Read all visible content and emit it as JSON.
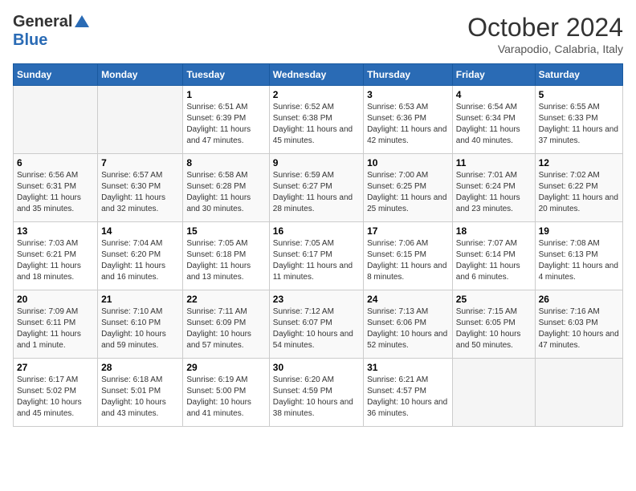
{
  "header": {
    "logo_general": "General",
    "logo_blue": "Blue",
    "month_title": "October 2024",
    "subtitle": "Varapodio, Calabria, Italy"
  },
  "days_of_week": [
    "Sunday",
    "Monday",
    "Tuesday",
    "Wednesday",
    "Thursday",
    "Friday",
    "Saturday"
  ],
  "weeks": [
    [
      {
        "day": null,
        "info": null
      },
      {
        "day": null,
        "info": null
      },
      {
        "day": "1",
        "info": "Sunrise: 6:51 AM\nSunset: 6:39 PM\nDaylight: 11 hours and 47 minutes."
      },
      {
        "day": "2",
        "info": "Sunrise: 6:52 AM\nSunset: 6:38 PM\nDaylight: 11 hours and 45 minutes."
      },
      {
        "day": "3",
        "info": "Sunrise: 6:53 AM\nSunset: 6:36 PM\nDaylight: 11 hours and 42 minutes."
      },
      {
        "day": "4",
        "info": "Sunrise: 6:54 AM\nSunset: 6:34 PM\nDaylight: 11 hours and 40 minutes."
      },
      {
        "day": "5",
        "info": "Sunrise: 6:55 AM\nSunset: 6:33 PM\nDaylight: 11 hours and 37 minutes."
      }
    ],
    [
      {
        "day": "6",
        "info": "Sunrise: 6:56 AM\nSunset: 6:31 PM\nDaylight: 11 hours and 35 minutes."
      },
      {
        "day": "7",
        "info": "Sunrise: 6:57 AM\nSunset: 6:30 PM\nDaylight: 11 hours and 32 minutes."
      },
      {
        "day": "8",
        "info": "Sunrise: 6:58 AM\nSunset: 6:28 PM\nDaylight: 11 hours and 30 minutes."
      },
      {
        "day": "9",
        "info": "Sunrise: 6:59 AM\nSunset: 6:27 PM\nDaylight: 11 hours and 28 minutes."
      },
      {
        "day": "10",
        "info": "Sunrise: 7:00 AM\nSunset: 6:25 PM\nDaylight: 11 hours and 25 minutes."
      },
      {
        "day": "11",
        "info": "Sunrise: 7:01 AM\nSunset: 6:24 PM\nDaylight: 11 hours and 23 minutes."
      },
      {
        "day": "12",
        "info": "Sunrise: 7:02 AM\nSunset: 6:22 PM\nDaylight: 11 hours and 20 minutes."
      }
    ],
    [
      {
        "day": "13",
        "info": "Sunrise: 7:03 AM\nSunset: 6:21 PM\nDaylight: 11 hours and 18 minutes."
      },
      {
        "day": "14",
        "info": "Sunrise: 7:04 AM\nSunset: 6:20 PM\nDaylight: 11 hours and 16 minutes."
      },
      {
        "day": "15",
        "info": "Sunrise: 7:05 AM\nSunset: 6:18 PM\nDaylight: 11 hours and 13 minutes."
      },
      {
        "day": "16",
        "info": "Sunrise: 7:05 AM\nSunset: 6:17 PM\nDaylight: 11 hours and 11 minutes."
      },
      {
        "day": "17",
        "info": "Sunrise: 7:06 AM\nSunset: 6:15 PM\nDaylight: 11 hours and 8 minutes."
      },
      {
        "day": "18",
        "info": "Sunrise: 7:07 AM\nSunset: 6:14 PM\nDaylight: 11 hours and 6 minutes."
      },
      {
        "day": "19",
        "info": "Sunrise: 7:08 AM\nSunset: 6:13 PM\nDaylight: 11 hours and 4 minutes."
      }
    ],
    [
      {
        "day": "20",
        "info": "Sunrise: 7:09 AM\nSunset: 6:11 PM\nDaylight: 11 hours and 1 minute."
      },
      {
        "day": "21",
        "info": "Sunrise: 7:10 AM\nSunset: 6:10 PM\nDaylight: 10 hours and 59 minutes."
      },
      {
        "day": "22",
        "info": "Sunrise: 7:11 AM\nSunset: 6:09 PM\nDaylight: 10 hours and 57 minutes."
      },
      {
        "day": "23",
        "info": "Sunrise: 7:12 AM\nSunset: 6:07 PM\nDaylight: 10 hours and 54 minutes."
      },
      {
        "day": "24",
        "info": "Sunrise: 7:13 AM\nSunset: 6:06 PM\nDaylight: 10 hours and 52 minutes."
      },
      {
        "day": "25",
        "info": "Sunrise: 7:15 AM\nSunset: 6:05 PM\nDaylight: 10 hours and 50 minutes."
      },
      {
        "day": "26",
        "info": "Sunrise: 7:16 AM\nSunset: 6:03 PM\nDaylight: 10 hours and 47 minutes."
      }
    ],
    [
      {
        "day": "27",
        "info": "Sunrise: 6:17 AM\nSunset: 5:02 PM\nDaylight: 10 hours and 45 minutes."
      },
      {
        "day": "28",
        "info": "Sunrise: 6:18 AM\nSunset: 5:01 PM\nDaylight: 10 hours and 43 minutes."
      },
      {
        "day": "29",
        "info": "Sunrise: 6:19 AM\nSunset: 5:00 PM\nDaylight: 10 hours and 41 minutes."
      },
      {
        "day": "30",
        "info": "Sunrise: 6:20 AM\nSunset: 4:59 PM\nDaylight: 10 hours and 38 minutes."
      },
      {
        "day": "31",
        "info": "Sunrise: 6:21 AM\nSunset: 4:57 PM\nDaylight: 10 hours and 36 minutes."
      },
      {
        "day": null,
        "info": null
      },
      {
        "day": null,
        "info": null
      }
    ]
  ]
}
